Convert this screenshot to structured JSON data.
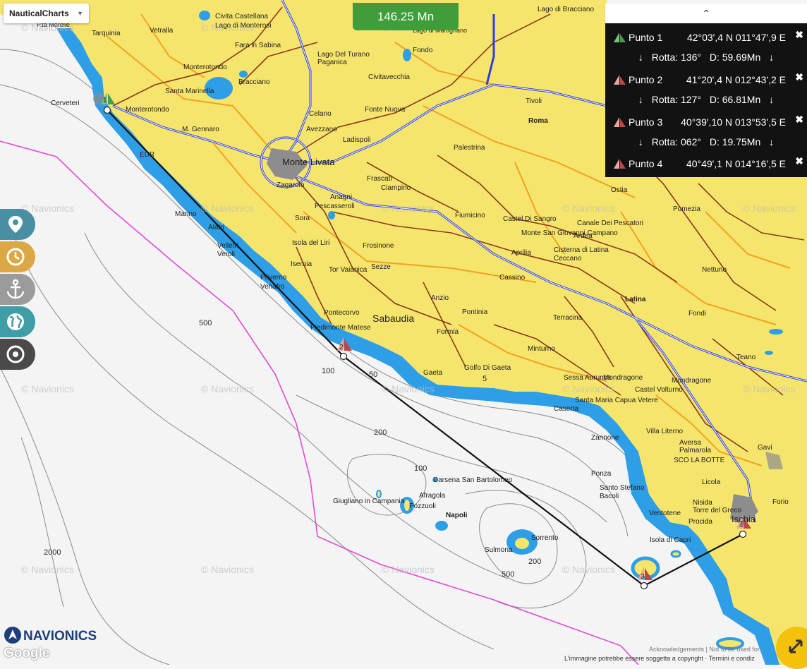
{
  "app": {
    "layer_select": "NauticalCharts",
    "total_distance": "146.25 Mn",
    "brand": "NAVIONICS",
    "google": "Google",
    "attribution": "L'immagine potrebbe essere soggetta a copyright",
    "terms": "Termini e condiz",
    "acknowledgements": "Acknowledgements | Not to be used for",
    "watermark": "© Navionics"
  },
  "route": {
    "waypoints": [
      {
        "name": "Punto 1",
        "coord": "42°03',4 N  011°47',9 E",
        "marker": "1"
      },
      {
        "name": "Punto 2",
        "coord": "41°20',4 N  012°43',2 E",
        "marker": "2"
      },
      {
        "name": "Punto 3",
        "coord": "40°39',10 N  013°53',5 E",
        "marker": "3"
      },
      {
        "name": "Punto 4",
        "coord": "40°49',1 N  014°16',5 E",
        "marker": "4"
      }
    ],
    "legs": [
      {
        "course": "Rotta: 136°",
        "distance": "D: 59.69Mn"
      },
      {
        "course": "Rotta: 127°",
        "distance": "D: 66.81Mn"
      },
      {
        "course": "Rotta: 062°",
        "distance": "D: 19.75Mn"
      }
    ],
    "leg_arrow": "↓",
    "remove_glyph": "✖",
    "collapse_glyph": "⌃"
  },
  "places": [
    "P.ta Morelle",
    "Tarquinia",
    "Vetralla",
    "Civita Castellana",
    "Lago di Monterosi",
    "Fara in Sabina",
    "Lago Del Turano",
    "Paganica",
    "Fondo",
    "Lago di Bracciano",
    "Lago di Martignano",
    "Monterotondo",
    "Bracciano",
    "Civitavecchia",
    "Santa Marinella",
    "Cerveteri",
    "Monterotondo",
    "M. Gennaro",
    "Celano",
    "Fonte Nuova",
    "Tivoli",
    "Avezzano",
    "Ladispoli",
    "Roma",
    "EUR",
    "Monte Livata",
    "Zagarolo",
    "Palestrina",
    "Frascati",
    "Ciampino",
    "Anagni",
    "Pescasseroli",
    "Fiumicino",
    "Ostia",
    "Marino",
    "Alatri",
    "Sora",
    "Castel Di Sangro",
    "Canale Dei Pescatori",
    "Pomezia",
    "Velletri",
    "Veroli",
    "Isola del Liri",
    "Frosinone",
    "Monte San Giovanni Campano",
    "Ardea",
    "Aprilia",
    "Cisterna di Latina",
    "Ceccano",
    "Isernia",
    "Tor Vaianica",
    "Sezze",
    "Cassino",
    "Nettuno",
    "Priverno",
    "Venafro",
    "Anzio",
    "Latina",
    "Pontecorvo",
    "Pontinia",
    "Fondi",
    "Piedimonte Matese",
    "Sabaudia",
    "Terracina",
    "Formia",
    "Minturno",
    "Teano",
    "Gaeta",
    "Golfo Di Gaeta",
    "Sessa Aurunca",
    "Mondragone",
    "Mondragone",
    "Santa Maria Capua Vetere",
    "Caserta",
    "Castel Volturno",
    "Villa Literno",
    "Zannone",
    "Aversa",
    "Palmarola",
    "Gavi",
    "Ponza",
    "SCO LA BOTTE",
    "Darsena San Bartolomeo",
    "Licola",
    "Giugliano in Campania",
    "Afragola",
    "Pozzuoli",
    "Napoli",
    "Santo Stefano",
    "Bacoli",
    "Ventotene",
    "Nisida",
    "Torre del Greco",
    "Forio",
    "Procida",
    "Ischia",
    "Sorrento",
    "Isola di Capri",
    "Sulmona"
  ],
  "depths": [
    "500",
    "2000",
    "100",
    "50",
    "200",
    "100",
    "200",
    "500",
    "5"
  ],
  "colors": {
    "land": "#f6e56c",
    "shallow": "#2e9ee6",
    "sea": "#f4f4f4",
    "route_line": "#111111",
    "boundary": "#e34bd6",
    "highway": "#2f3fd6",
    "road": "#8a3a1c",
    "secondary_road": "#f3a21f",
    "panel_bg": "#121212",
    "badge": "#3f9d3a"
  },
  "side_tools": [
    {
      "icon": "location-pin-icon",
      "color": "#4a8ea3"
    },
    {
      "icon": "clock-icon",
      "color": "#dca846"
    },
    {
      "icon": "anchor-icon",
      "color": "#9b9b9b"
    },
    {
      "icon": "globe-icon",
      "color": "#3e9da7"
    },
    {
      "icon": "target-icon",
      "color": "#4a4a4a"
    }
  ]
}
